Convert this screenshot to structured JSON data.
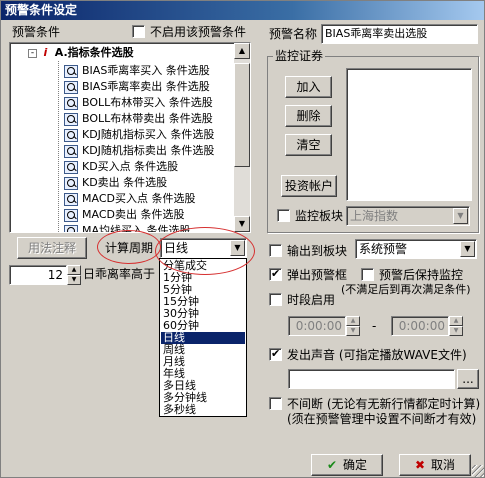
{
  "window": {
    "title": "预警条件设定"
  },
  "left": {
    "conditions_label": "预警条件",
    "disable_checkbox_label": "不启用该预警条件",
    "tree_category": "A.指标条件选股",
    "tree_items": [
      "BIAS乖离率买入  条件选股",
      "BIAS乖离率卖出  条件选股",
      "BOLL布林带买入  条件选股",
      "BOLL布林带卖出  条件选股",
      "KDJ随机指标买入  条件选股",
      "KDJ随机指标卖出  条件选股",
      "KD买入点  条件选股",
      "KD卖出  条件选股",
      "MACD买入点  条件选股",
      "MACD卖出  条件选股",
      "MA均线买入  条件选股"
    ],
    "usage_button": "用法注释",
    "period_label": "计算周期",
    "period_value": "日线",
    "spin_value": "12",
    "param_text": "日乖离率高于"
  },
  "dropdown": {
    "items": [
      "分笔成交",
      "1分钟",
      "5分钟",
      "15分钟",
      "30分钟",
      "60分钟",
      "日线",
      "周线",
      "月线",
      "年线",
      "多日线",
      "多分钟线",
      "多秒线"
    ],
    "selected_index": 6
  },
  "right": {
    "name_label": "预警名称",
    "name_value": "BIAS乖离率卖出选股",
    "monitor_group": "监控证券",
    "add_button": "加入",
    "delete_button": "删除",
    "clear_button": "清空",
    "account_button": "投资帐户",
    "monitor_board_label": "监控板块",
    "monitor_board_value": "上海指数",
    "output_board_label": "输出到板块",
    "output_board_value": "系统预警",
    "popup_label": "弹出预警框",
    "keep_monitor_label": "预警后保持监控",
    "keep_monitor_note": "(不满足后到再次满足条件)",
    "period_enable_label": "时段启用",
    "time_start": "0:00:00",
    "time_dash": "-",
    "time_end": "0:00:00",
    "sound_label": "发出声音 (可指定播放WAVE文件)",
    "sound_path": "",
    "browse_button": "...",
    "nonstop_label": "不间断 (无论有无新行情都定时计算)",
    "nonstop_note": "(须在预警管理中设置不间断才有效)",
    "ok_button": "确定",
    "cancel_button": "取消"
  }
}
